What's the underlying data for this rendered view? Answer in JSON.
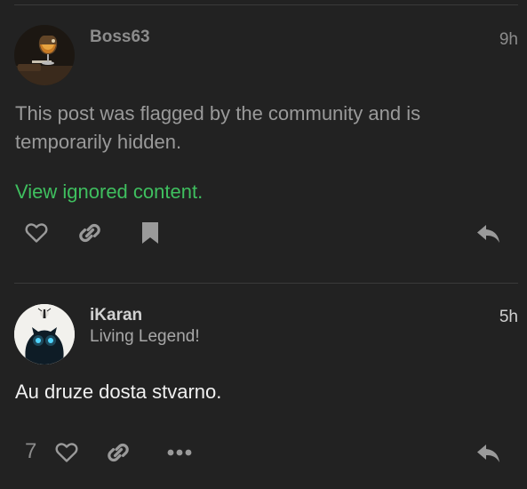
{
  "colors": {
    "background": "#222222",
    "username_dim": "#8c8c8c",
    "username": "#d2d2d2",
    "muted_text": "#9a9a9a",
    "body_text": "#f0f0f0",
    "link_green": "#3fbf5f",
    "icon_gray": "#9a9a9a",
    "icon_light": "#c2c2c2"
  },
  "posts": [
    {
      "username": "Boss63",
      "time": "9h",
      "avatar_icon": "cognac-glass-avatar",
      "hidden_notice": "This post was flagged by the community and is temporarily hidden.",
      "view_link": "View ignored content.",
      "actions": [
        "heart-icon",
        "link-icon",
        "bookmark-icon",
        "reply-icon"
      ]
    },
    {
      "username": "iKaran",
      "user_title": "Living Legend!",
      "time": "5h",
      "avatar_icon": "glowing-eyes-creature-avatar",
      "body": "Au druze dosta stvarno.",
      "like_count": "7",
      "actions": [
        "heart-icon",
        "link-icon",
        "more-icon",
        "reply-icon"
      ]
    }
  ]
}
